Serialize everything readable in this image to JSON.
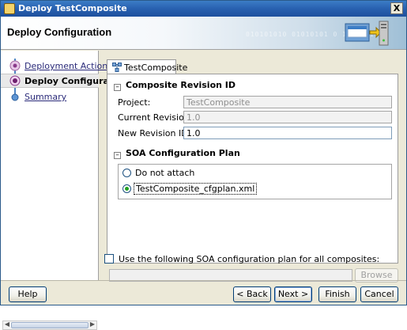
{
  "window": {
    "title": "Deploy TestComposite",
    "close_glyph": "X"
  },
  "banner": {
    "title": "Deploy Configuration",
    "decor_text": "010101010 01010101 0 10101010"
  },
  "nav": {
    "items": [
      {
        "label": "Deployment Action",
        "state": "visited"
      },
      {
        "label": "Deploy Configuration",
        "state": "active"
      },
      {
        "label": "Summary",
        "state": "pending"
      }
    ]
  },
  "tab": {
    "label": "TestComposite",
    "icon": "composite-icon"
  },
  "composite_revision": {
    "header": "Composite Revision ID",
    "project_label": "Project:",
    "project_value": "TestComposite",
    "current_label": "Current Revision ID:",
    "current_value": "1.0",
    "new_label": "New Revision ID:",
    "new_value": "1.0"
  },
  "soa_plan": {
    "header": "SOA Configuration Plan",
    "options": [
      {
        "label": "Do not attach",
        "selected": false
      },
      {
        "label": "TestComposite_cfgplan.xml",
        "selected": true
      }
    ]
  },
  "bottom": {
    "checkbox_label": "Use the following SOA configuration plan for all composites:",
    "checked": false,
    "browse_label": "Browse"
  },
  "buttons": {
    "help": "Help",
    "back": "< Back",
    "next": "Next >",
    "finish": "Finish",
    "cancel": "Cancel"
  },
  "colors": {
    "title_bar": "#2a63b2",
    "selected_radio": "#21a121",
    "link": "#2b2b7a"
  }
}
